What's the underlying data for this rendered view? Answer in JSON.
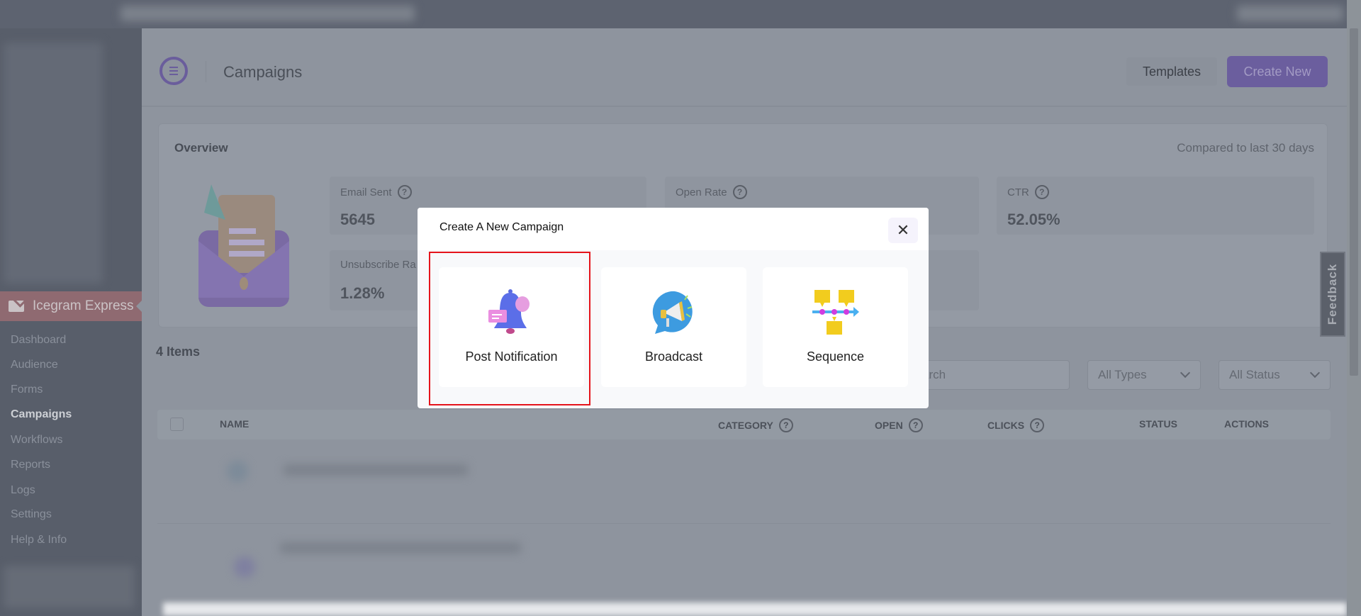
{
  "sidebar": {
    "brand": "Icegram Express",
    "items": [
      {
        "label": "Dashboard"
      },
      {
        "label": "Audience"
      },
      {
        "label": "Forms"
      },
      {
        "label": "Campaigns",
        "active": true
      },
      {
        "label": "Workflows"
      },
      {
        "label": "Reports"
      },
      {
        "label": "Logs"
      },
      {
        "label": "Settings"
      },
      {
        "label": "Help & Info"
      }
    ]
  },
  "header": {
    "title": "Campaigns",
    "templates_label": "Templates",
    "create_label": "Create New"
  },
  "overview": {
    "title": "Overview",
    "compare": "Compared to last 30 days",
    "stats": [
      {
        "label": "Email Sent",
        "value": "5645"
      },
      {
        "label": "Open Rate",
        "value": ""
      },
      {
        "label": "CTR",
        "value": "52.05%"
      },
      {
        "label": "Unsubscribe Ra",
        "value": "1.28%"
      }
    ]
  },
  "list": {
    "count": "4 Items",
    "search_placeholder": "arch",
    "type_filter": "All Types",
    "status_filter": "All Status",
    "columns": [
      "NAME",
      "CATEGORY",
      "OPEN",
      "CLICKS",
      "STATUS",
      "ACTIONS"
    ]
  },
  "feedback": "Feedback",
  "modal": {
    "title": "Create A New Campaign",
    "close": "✕",
    "options": [
      {
        "label": "Post Notification",
        "icon": "bell-icon"
      },
      {
        "label": "Broadcast",
        "icon": "megaphone-icon"
      },
      {
        "label": "Sequence",
        "icon": "sequence-icon"
      }
    ]
  },
  "colors": {
    "accent": "#7e6bc4",
    "highlight": "#e5141b"
  }
}
